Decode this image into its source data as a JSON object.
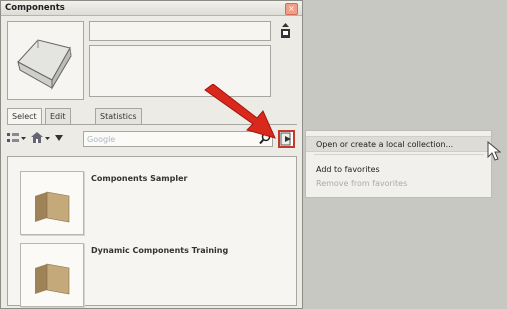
{
  "window": {
    "title": "Components"
  },
  "tabs": [
    "Select",
    "Edit",
    "Statistics"
  ],
  "search": {
    "placeholder": "Google"
  },
  "components": [
    {
      "name": "Components Sampler"
    },
    {
      "name": "Dynamic Components Training"
    }
  ],
  "context_menu": {
    "items": [
      {
        "label": "Open or create a local collection...",
        "state": "highlighted"
      },
      {
        "label": "Add to favorites",
        "state": "enabled"
      },
      {
        "label": "Remove from favorites",
        "state": "disabled"
      }
    ]
  },
  "icons": {
    "close": "close-icon",
    "upload": "upload-icon",
    "view_options": "view-options-icon",
    "home": "home-icon",
    "navigation_dropdown": "dropdown-icon",
    "search": "search-icon",
    "details": "details-arrow-icon",
    "callout_arrow": "red-arrow-icon",
    "cursor": "mouse-cursor-icon"
  },
  "colors": {
    "callout_arrow": "#d9281c",
    "details_highlight": "#c23a2a"
  }
}
